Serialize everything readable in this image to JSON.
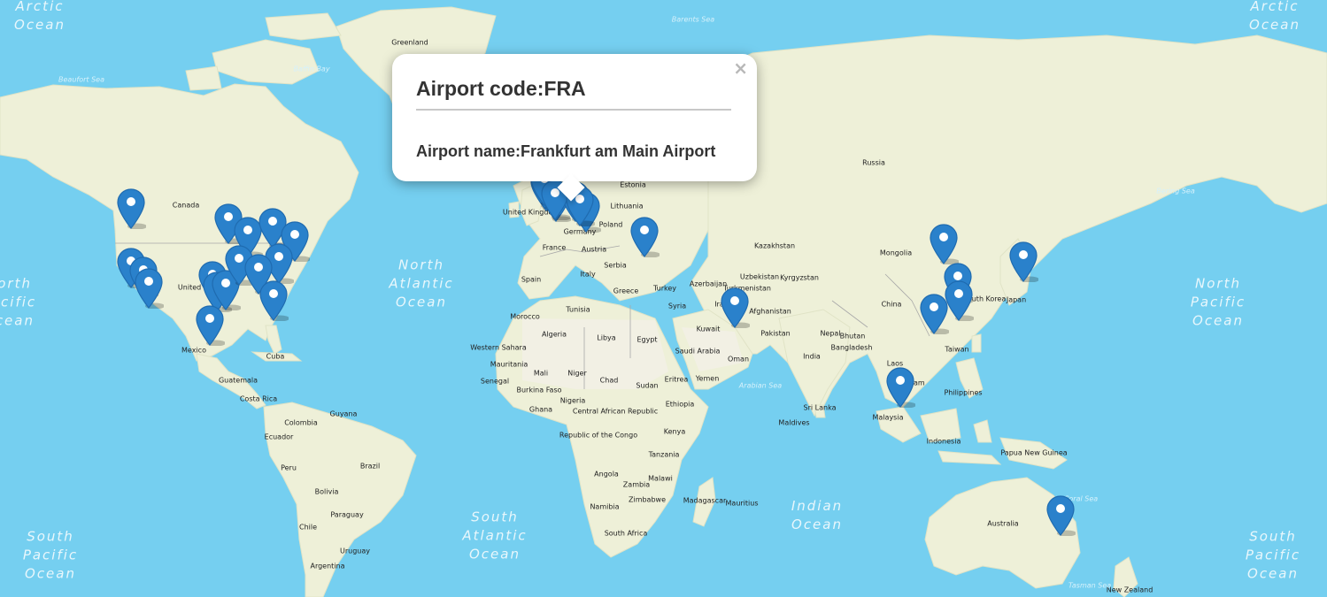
{
  "map": {
    "country_labels": [
      "Greenland",
      "Canada",
      "Russia",
      "Kazakhstan",
      "Mongolia",
      "China",
      "Japan",
      "India",
      "Pakistan",
      "Afghanistan",
      "Iran",
      "Turkey",
      "Greece",
      "Italy",
      "Spain",
      "France",
      "Poland",
      "Estonia",
      "Lithuania",
      "Germany",
      "Austria",
      "Serbia",
      "Morocco",
      "Algeria",
      "Libya",
      "Egypt",
      "Tunisia",
      "Western Sahara",
      "Mauritania",
      "Mali",
      "Niger",
      "Chad",
      "Sudan",
      "Senegal",
      "Burkina Faso",
      "Ghana",
      "Nigeria",
      "Central African Republic",
      "Ethiopia",
      "Kenya",
      "Republic of the Congo",
      "Tanzania",
      "Angola",
      "Zambia",
      "Malawi",
      "Zimbabwe",
      "Namibia",
      "Madagascar",
      "Mauritius",
      "South Africa",
      "Saudi Arabia",
      "Oman",
      "Kuwait",
      "Syria",
      "Yemen",
      "Eritrea",
      "Uzbekistan",
      "Kyrgyzstan",
      "Turkmenistan",
      "Azerbaijan",
      "Nepal",
      "Bhutan",
      "Bangladesh",
      "Sri Lanka",
      "Maldives",
      "Laos",
      "Vietnam",
      "Philippines",
      "Taiwan",
      "South Korea",
      "Malaysia",
      "Indonesia",
      "Papua New Guinea",
      "Australia",
      "New Zealand",
      "Mexico",
      "Cuba",
      "Guatemala",
      "Costa Rica",
      "Guyana",
      "Colombia",
      "Ecuador",
      "Peru",
      "Brazil",
      "Bolivia",
      "Paraguay",
      "Chile",
      "Uruguay",
      "Argentina",
      "United Kingdom",
      "United States"
    ],
    "ocean_labels": [
      "Arctic Ocean",
      "Arctic Ocean",
      "North Atlantic Ocean",
      "North Pacific Ocean",
      "North Pacific Ocean",
      "South Atlantic Ocean",
      "Indian Ocean",
      "South Pacific Ocean",
      "South Pacific Ocean"
    ],
    "sea_labels": [
      "Barents Sea",
      "Beaufort Sea",
      "Baffin Bay",
      "Bering Sea",
      "Arabian Sea",
      "Coral Sea",
      "Tasman Sea"
    ]
  },
  "markers": [
    "marker",
    "marker",
    "marker",
    "marker",
    "marker",
    "marker",
    "marker",
    "marker",
    "marker",
    "marker",
    "marker",
    "marker",
    "marker",
    "marker",
    "marker",
    "marker",
    "marker",
    "marker",
    "marker",
    "marker",
    "marker",
    "marker",
    "marker",
    "marker",
    "marker",
    "marker",
    "marker",
    "marker",
    "marker",
    "marker",
    "marker",
    "marker",
    "marker"
  ],
  "popup": {
    "code_text": "Airport code:FRA",
    "name_text": "Airport name:Frankfurt am Main Airport",
    "close_glyph": "×"
  },
  "colors": {
    "water": "#75cff0",
    "land": "#eef0d8",
    "land_desert": "#f2efe6",
    "border": "#a8a8a8",
    "marker": "#2a81cb",
    "marker_dark": "#1f6bb0"
  }
}
